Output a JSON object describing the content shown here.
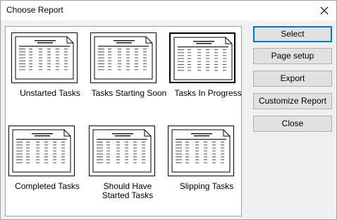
{
  "window": {
    "title": "Choose Report",
    "close_glyph": "✕"
  },
  "reports": [
    {
      "label": "Unstarted Tasks",
      "selected": false
    },
    {
      "label": "Tasks Starting Soon",
      "selected": false
    },
    {
      "label": "Tasks In Progress",
      "selected": true
    },
    {
      "label": "Completed Tasks",
      "selected": false
    },
    {
      "label": "Should Have\nStarted Tasks",
      "selected": false
    },
    {
      "label": "Slipping Tasks",
      "selected": false
    }
  ],
  "buttons": {
    "select": "Select",
    "page_setup": "Page setup",
    "export": "Export",
    "customize": "Customize Report",
    "close": "Close"
  },
  "icons": {
    "report_thumbnail": "report-page-icon",
    "close": "close-icon"
  }
}
